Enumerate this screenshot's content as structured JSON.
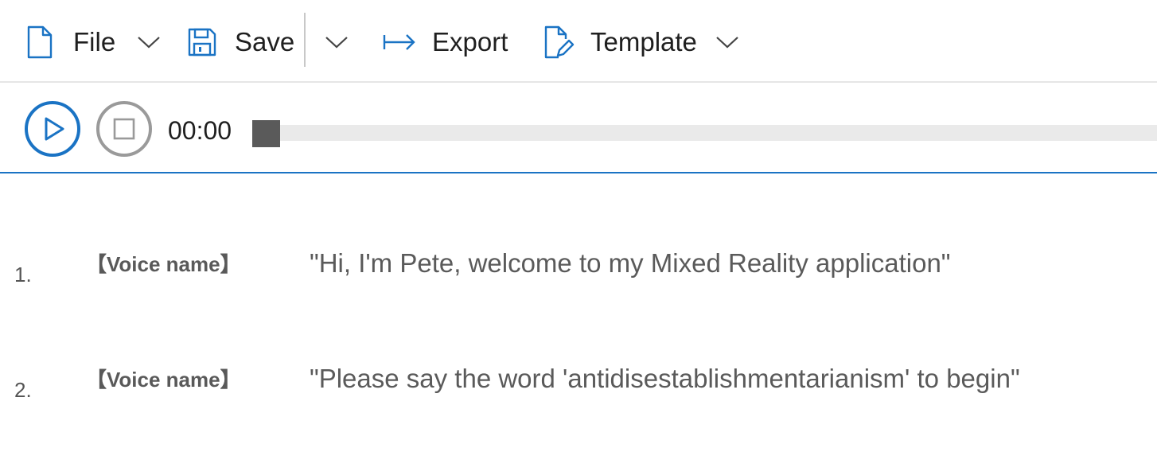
{
  "toolbar": {
    "file_label": "File",
    "save_label": "Save",
    "export_label": "Export",
    "template_label": "Template"
  },
  "player": {
    "time": "00:00",
    "progress": 0
  },
  "script_lines": [
    {
      "number": "1.",
      "voice": "【Voice name】",
      "text": "\"Hi, I'm Pete, welcome to my Mixed Reality application\""
    },
    {
      "number": "2.",
      "voice": "【Voice name】",
      "text": "\"Please say the word 'antidisestablishmentarianism' to begin\""
    }
  ],
  "icons": {
    "file": "file-icon",
    "save": "save-icon",
    "export": "export-icon",
    "template": "template-edit-icon",
    "play": "play-icon",
    "stop": "stop-icon",
    "chevron": "chevron-down-icon"
  },
  "colors": {
    "accent": "#1a73c4",
    "icon_blue": "#1a73c4",
    "stop_gray": "#9a9a9a",
    "progress_thumb": "#5a5a5a",
    "track": "#eaeaea",
    "text_gray": "#5a5a5a"
  }
}
